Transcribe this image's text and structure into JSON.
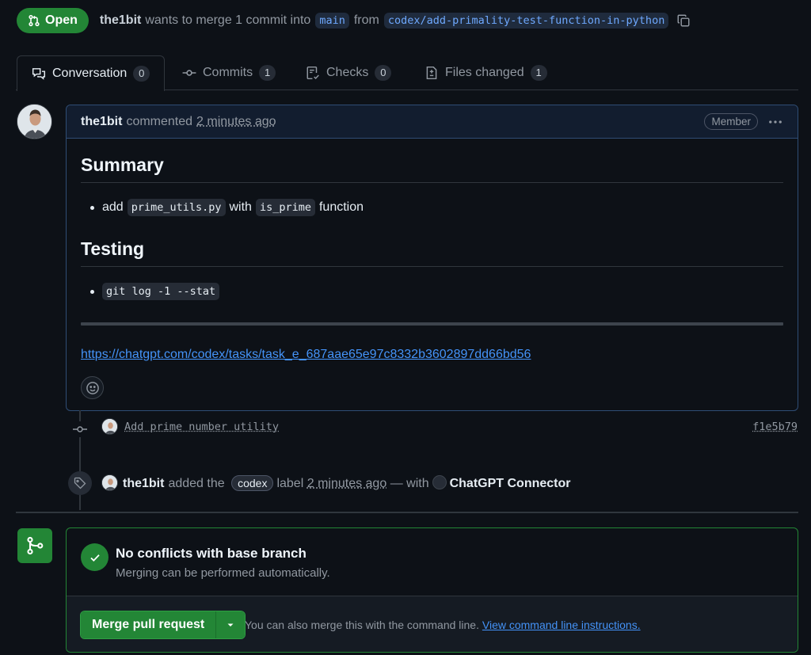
{
  "header": {
    "state": "Open",
    "author": "the1bit",
    "merge_text": "wants to merge 1 commit into",
    "base_branch": "main",
    "from_text": "from",
    "head_branch": "codex/add-primality-test-function-in-python"
  },
  "tabs": [
    {
      "label": "Conversation",
      "count": "0"
    },
    {
      "label": "Commits",
      "count": "1"
    },
    {
      "label": "Checks",
      "count": "0"
    },
    {
      "label": "Files changed",
      "count": "1"
    }
  ],
  "comment": {
    "author": "the1bit",
    "action": "commented",
    "time": "2 minutes ago",
    "badge": "Member",
    "heading1": "Summary",
    "summary_item": {
      "pre": "add",
      "code1": "prime_utils.py",
      "mid": "with",
      "code2": "is_prime",
      "post": "function"
    },
    "heading2": "Testing",
    "testing_item": "git log -1 --stat",
    "link": "https://chatgpt.com/codex/tasks/task_e_687aae65e97c8332b3602897dd66bd56"
  },
  "commit": {
    "message": "Add prime number utility",
    "sha": "f1e5b79"
  },
  "label_event": {
    "author": "the1bit",
    "text1": "added the",
    "label": "codex",
    "text2": "label",
    "time": "2 minutes ago",
    "text3": "— with",
    "app": "ChatGPT Connector"
  },
  "merge": {
    "title": "No conflicts with base branch",
    "subtitle": "Merging can be performed automatically.",
    "button": "Merge pull request",
    "hint": "You can also merge this with the command line.",
    "hint_link": "View command line instructions."
  },
  "colors": {
    "success": "#238636",
    "accent": "#4493f8",
    "background": "#0d1117"
  }
}
